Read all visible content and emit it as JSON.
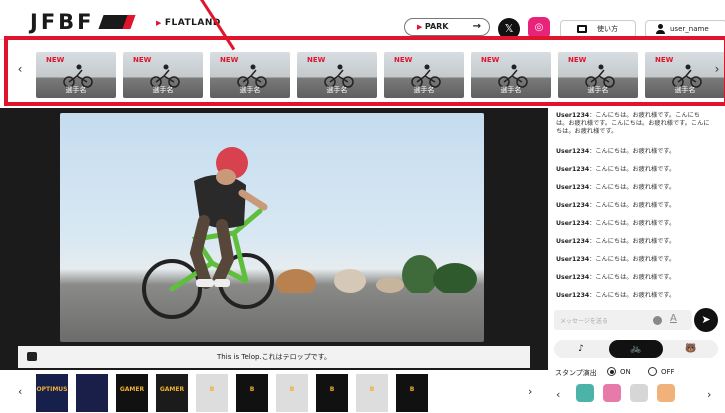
{
  "header": {
    "logo": "JFBF",
    "section": "FLATLAND",
    "park_label": "PARK",
    "park_arrow": "→",
    "x_label": "𝕏",
    "instagram_label": "◎",
    "howto_label": "使い方",
    "user_label": "user_name"
  },
  "riders": {
    "prev": "‹",
    "next": "›",
    "cards": [
      {
        "badge": "NEW",
        "name": "選手名"
      },
      {
        "badge": "NEW",
        "name": "選手名"
      },
      {
        "badge": "NEW",
        "name": "選手名"
      },
      {
        "badge": "NEW",
        "name": "選手名"
      },
      {
        "badge": "NEW",
        "name": "選手名"
      },
      {
        "badge": "NEW",
        "name": "選手名"
      },
      {
        "badge": "NEW",
        "name": "選手名"
      },
      {
        "badge": "NEW",
        "name": "選手名"
      }
    ]
  },
  "telop": {
    "text": "This is Telop.これはテロップです。"
  },
  "merch": {
    "prev": "‹",
    "next": "›",
    "items": [
      {
        "label": "OPTIMUS"
      },
      {
        "label": ""
      },
      {
        "label": "GAMER"
      },
      {
        "label": "GAMER"
      },
      {
        "label": "B"
      },
      {
        "label": "B"
      },
      {
        "label": "B"
      },
      {
        "label": "B"
      },
      {
        "label": "B"
      },
      {
        "label": "B"
      }
    ]
  },
  "chat": {
    "messages": [
      {
        "user": "User1234",
        "text": "：こんにちは。お疲れ様です。こんにちは。お疲れ様です。こんにちは。お疲れ様です。こんにちは。お疲れ様です。"
      },
      {
        "user": "User1234",
        "text": "：こんにちは。お疲れ様です。"
      },
      {
        "user": "User1234",
        "text": "：こんにちは。お疲れ様です。"
      },
      {
        "user": "User1234",
        "text": "：こんにちは。お疲れ様です。"
      },
      {
        "user": "User1234",
        "text": "：こんにちは。お疲れ様です。"
      },
      {
        "user": "User1234",
        "text": "：こんにちは。お疲れ様です。"
      },
      {
        "user": "User1234",
        "text": "：こんにちは。お疲れ様です。"
      },
      {
        "user": "User1234",
        "text": "：こんにちは。お疲れ様です。"
      },
      {
        "user": "User1234",
        "text": "：こんにちは。お疲れ様です。"
      },
      {
        "user": "User1234",
        "text": "：こんにちは。お疲れ様です。"
      }
    ],
    "input_placeholder": "メッセージを送る",
    "font_label": "A",
    "send_label": "➤",
    "tabs": [
      "♪",
      "🚲",
      "🐻"
    ],
    "stamp_label": "スタンプ演出",
    "on_label": "ON",
    "off_label": "OFF",
    "stamp_prev": "‹",
    "stamp_next": "›"
  },
  "colors": {
    "accent_red": "#e0142c",
    "instagram": "#e8247a"
  }
}
